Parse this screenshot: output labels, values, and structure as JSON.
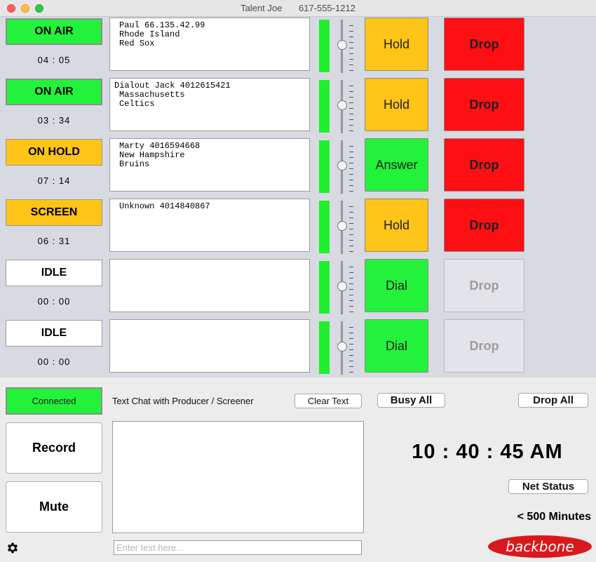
{
  "window": {
    "title": "Talent Joe",
    "phone": "617-555-1212"
  },
  "lines": [
    {
      "status": "ON AIR",
      "status_type": "onair",
      "timer": "04 : 05",
      "info": [
        "Paul 66.135.42.99",
        "Rhode Island",
        "Red Sox"
      ],
      "action": "Hold",
      "action_type": "hold",
      "drop": "Drop",
      "drop_enabled": true
    },
    {
      "status": "ON AIR",
      "status_type": "onair",
      "timer": "03 : 34",
      "info": [
        "Dialout Jack 4012615421",
        "Massachusetts",
        "Celtics"
      ],
      "action": "Hold",
      "action_type": "hold",
      "drop": "Drop",
      "drop_enabled": true
    },
    {
      "status": "ON HOLD",
      "status_type": "onhold",
      "timer": "07 : 14",
      "info": [
        "Marty 4016594668",
        "New Hampshire",
        "Bruins"
      ],
      "action": "Answer",
      "action_type": "answer",
      "drop": "Drop",
      "drop_enabled": true
    },
    {
      "status": "SCREEN",
      "status_type": "screen",
      "timer": "06 : 31",
      "info": [
        "Unknown 4014840867"
      ],
      "action": "Hold",
      "action_type": "hold",
      "drop": "Drop",
      "drop_enabled": true
    },
    {
      "status": "IDLE",
      "status_type": "idle",
      "timer": "00 : 00",
      "info": [],
      "action": "Dial",
      "action_type": "dial",
      "drop": "Drop",
      "drop_enabled": false
    },
    {
      "status": "IDLE",
      "status_type": "idle",
      "timer": "00 : 00",
      "info": [],
      "action": "Dial",
      "action_type": "dial",
      "drop": "Drop",
      "drop_enabled": false
    }
  ],
  "bottom": {
    "connected": "Connected",
    "record": "Record",
    "mute": "Mute",
    "chat_label": "Text Chat with Producer / Screener",
    "clear_text": "Clear Text",
    "busy_all": "Busy All",
    "drop_all": "Drop All",
    "chat_placeholder": "Enter text here...",
    "clock": "10 : 40 : 45 AM",
    "net_status": "Net Status",
    "minutes": "< 500 Minutes",
    "logo": "backbone"
  },
  "colors": {
    "on_air": "#23f23a",
    "on_hold": "#fec417",
    "drop": "#fe0f14",
    "meter": "#1ef02f",
    "logo": "#d9191d"
  }
}
